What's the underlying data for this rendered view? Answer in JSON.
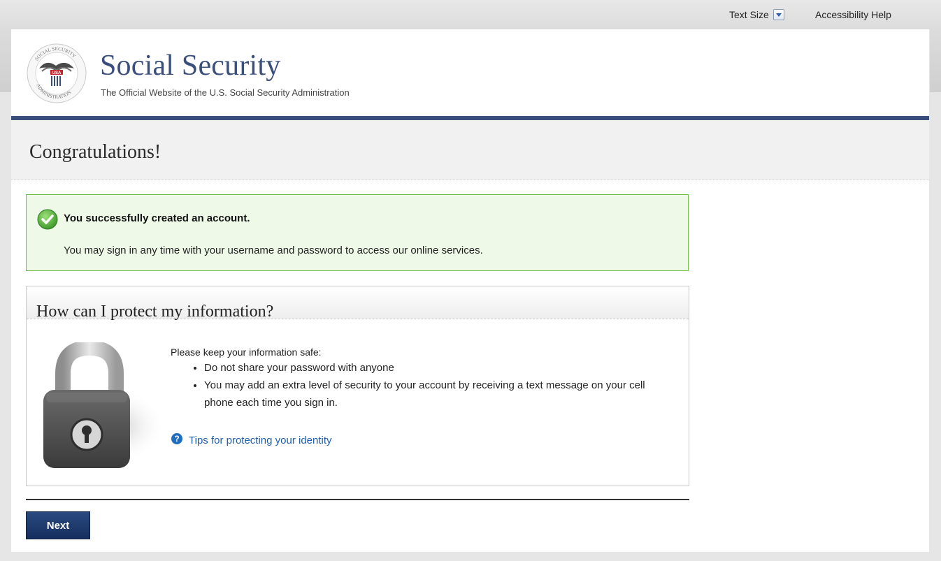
{
  "utility": {
    "text_size_label": "Text Size",
    "accessibility_label": "Accessibility Help"
  },
  "header": {
    "title": "Social Security",
    "subtitle": "The Official Website of the U.S. Social Security Administration",
    "seal_text": "SOCIAL SECURITY ADMINISTRATION USA"
  },
  "page": {
    "title": "Congratulations!"
  },
  "success": {
    "title": "You successfully created an account.",
    "message": "You may sign in any time with your username and password to access our online services."
  },
  "protect": {
    "title": "How can I protect my information?",
    "intro": "Please keep your information safe:",
    "items": [
      "Do not share your password with anyone",
      "You may add an extra level of security to your account by receiving a text message on your cell phone each time you sign in."
    ],
    "link": "Tips for protecting your identity"
  },
  "actions": {
    "next_label": "Next"
  },
  "colors": {
    "brand_navy": "#3b4f7d",
    "success_border": "#6fbd4a",
    "success_bg": "#eef9e8",
    "link_blue": "#1f5fae"
  }
}
